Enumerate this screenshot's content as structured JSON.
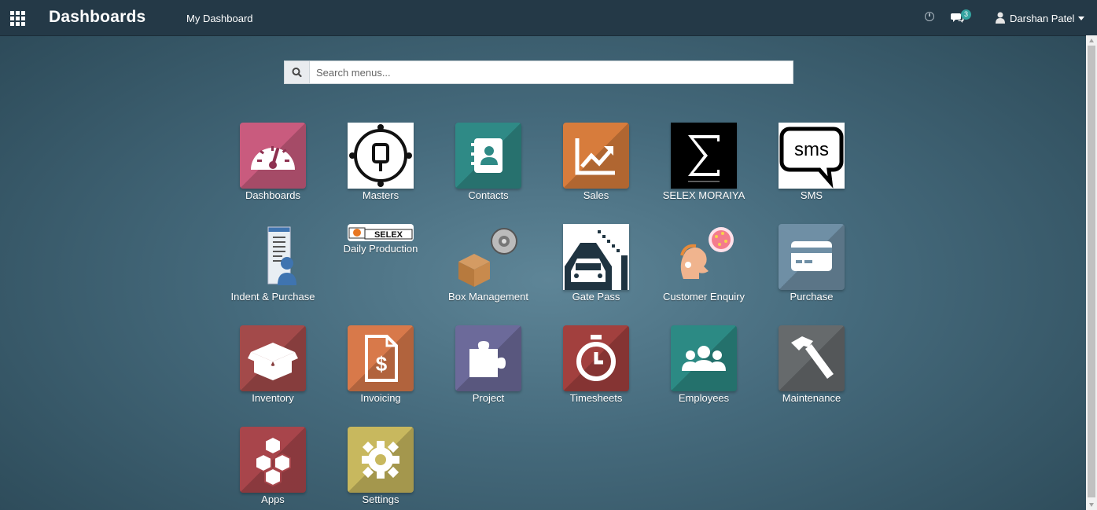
{
  "topbar": {
    "app_title": "Dashboards",
    "breadcrumb": "My Dashboard",
    "chat_count": "3",
    "user_name": "Darshan Patel"
  },
  "search": {
    "placeholder": "Search menus..."
  },
  "apps": [
    {
      "label": "Dashboards",
      "icon": "dashboard-gauge-icon",
      "color": "#c95b7e"
    },
    {
      "label": "Masters",
      "icon": "masters-node-icon",
      "color": "#ffffff"
    },
    {
      "label": "Contacts",
      "icon": "address-book-icon",
      "color": "#2f8a86"
    },
    {
      "label": "Sales",
      "icon": "chart-trend-icon",
      "color": "#d77c3c"
    },
    {
      "label": "SELEX MORAIYA",
      "icon": "sigma-icon",
      "color": "#000000"
    },
    {
      "label": "SMS",
      "icon": "sms-bubble-icon",
      "color": "#ffffff"
    },
    {
      "label": "Indent & Purchase",
      "icon": "document-user-icon",
      "color": "#e9eef2"
    },
    {
      "label": "Daily Production",
      "icon": "selex-logo-icon",
      "color": "#ffffff"
    },
    {
      "label": "Box Management",
      "icon": "box-gear-icon",
      "color": "#4a7085"
    },
    {
      "label": "Gate Pass",
      "icon": "car-gate-icon",
      "color": "#ffffff"
    },
    {
      "label": "Customer Enquiry",
      "icon": "customer-enquiry-icon",
      "color": "#4a7085"
    },
    {
      "label": "Purchase",
      "icon": "credit-card-icon",
      "color": "#6f8fa5"
    },
    {
      "label": "Inventory",
      "icon": "open-box-icon",
      "color": "#a34a4a"
    },
    {
      "label": "Invoicing",
      "icon": "invoice-dollar-icon",
      "color": "#d8794a"
    },
    {
      "label": "Project",
      "icon": "puzzle-icon",
      "color": "#6c6a9a"
    },
    {
      "label": "Timesheets",
      "icon": "stopwatch-icon",
      "color": "#a2403e"
    },
    {
      "label": "Employees",
      "icon": "team-icon",
      "color": "#2c8a84"
    },
    {
      "label": "Maintenance",
      "icon": "hammer-icon",
      "color": "#666a6c"
    },
    {
      "label": "Apps",
      "icon": "cubes-icon",
      "color": "#a8454b"
    },
    {
      "label": "Settings",
      "icon": "gear-icon",
      "color": "#c8b85e"
    }
  ]
}
